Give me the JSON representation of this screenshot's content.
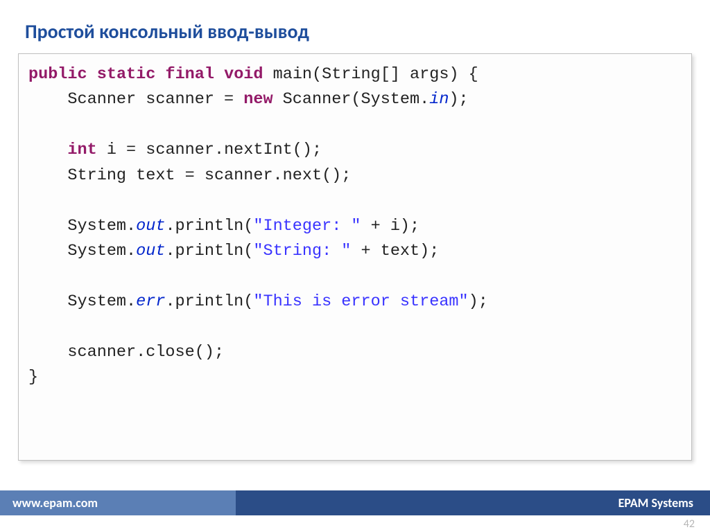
{
  "title": "Простой консольный ввод-вывод",
  "code": {
    "kw_public": "public",
    "kw_static": "static",
    "kw_final": "final",
    "kw_void": "void",
    "sig_tail": " main(String[] args) {",
    "l2a": "    Scanner scanner = ",
    "kw_new": "new",
    "l2b": " Scanner(System.",
    "fld_in": "in",
    "l2c": ");",
    "l4a": "    ",
    "kw_int": "int",
    "l4b": " i = scanner.nextInt();",
    "l5": "    String text = scanner.next();",
    "l7a": "    System.",
    "fld_out": "out",
    "l7b": ".println(",
    "str_int": "\"Integer: \"",
    "l7c": " + i);",
    "l8a": "    System.",
    "l8b": ".println(",
    "str_str": "\"String: \"",
    "l8c": " + text);",
    "l10a": "    System.",
    "fld_err": "err",
    "l10b": ".println(",
    "str_err": "\"This is error stream\"",
    "l10c": ");",
    "l12": "    scanner.close();",
    "l13": "}"
  },
  "footer": {
    "url": "www.epam.com",
    "company": "EPAM Systems"
  },
  "page_number": "42"
}
